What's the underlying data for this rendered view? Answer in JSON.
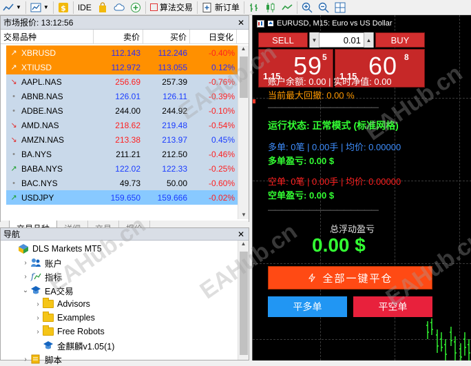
{
  "toolbar": {
    "ide_label": "IDE",
    "algo_label": "算法交易",
    "new_order_label": "新订单"
  },
  "market_watch": {
    "title": "市场报价: 13:12:56",
    "headers": {
      "symbol": "交易品种",
      "bid": "卖价",
      "ask": "买价",
      "change": "日变化"
    },
    "rows": [
      {
        "symbol": "XBRUSD",
        "bid": "112.143",
        "ask": "112.246",
        "change": "-0.40%",
        "dir": "up"
      },
      {
        "symbol": "XTIUSD",
        "bid": "112.972",
        "ask": "113.055",
        "change": "0.12%",
        "dir": "up"
      },
      {
        "symbol": "AAPL.NAS",
        "bid": "256.69",
        "ask": "257.39",
        "change": "-0.76%",
        "dir": "down"
      },
      {
        "symbol": "ABNB.NAS",
        "bid": "126.01",
        "ask": "126.11",
        "change": "-0.39%",
        "dir": "none"
      },
      {
        "symbol": "ADBE.NAS",
        "bid": "244.00",
        "ask": "244.92",
        "change": "-0.10%",
        "dir": "none"
      },
      {
        "symbol": "AMD.NAS",
        "bid": "218.62",
        "ask": "219.48",
        "change": "-0.54%",
        "dir": "down"
      },
      {
        "symbol": "AMZN.NAS",
        "bid": "213.38",
        "ask": "213.97",
        "change": "0.45%",
        "dir": "down"
      },
      {
        "symbol": "BA.NYS",
        "bid": "211.21",
        "ask": "212.50",
        "change": "-0.46%",
        "dir": "none"
      },
      {
        "symbol": "BABA.NYS",
        "bid": "122.02",
        "ask": "122.33",
        "change": "-0.25%",
        "dir": "up"
      },
      {
        "symbol": "BAC.NYS",
        "bid": "49.73",
        "ask": "50.00",
        "change": "-0.60%",
        "dir": "none"
      },
      {
        "symbol": "USDJPY",
        "bid": "159.650",
        "ask": "159.666",
        "change": "-0.02%",
        "dir": "up"
      }
    ],
    "tabs": [
      "交易品种",
      "详细",
      "交易",
      "报价"
    ]
  },
  "navigator": {
    "title": "导航",
    "items": [
      {
        "label": "DLS Markets MT5",
        "level": 0,
        "exp": ""
      },
      {
        "label": "账户",
        "level": 1,
        "exp": ">"
      },
      {
        "label": "指标",
        "level": 1,
        "exp": ">"
      },
      {
        "label": "EA交易",
        "level": 1,
        "exp": "v"
      },
      {
        "label": "Advisors",
        "level": 2,
        "exp": ">"
      },
      {
        "label": "Examples",
        "level": 2,
        "exp": ">"
      },
      {
        "label": "Free Robots",
        "level": 2,
        "exp": ">"
      },
      {
        "label": "金麒麟v1.05(1)",
        "level": 2,
        "exp": ""
      },
      {
        "label": "脚本",
        "level": 1,
        "exp": ">"
      }
    ]
  },
  "chart": {
    "title": "EURUSD, M15: Euro vs US Dollar",
    "sell_label": "SELL",
    "buy_label": "BUY",
    "lot": "0.01",
    "sell_price": {
      "prefix": "1.15",
      "big": "59",
      "sup": "5"
    },
    "buy_price": {
      "prefix": "1.15",
      "big": "60",
      "sup": "8"
    },
    "balance_line": "账户余额: 0.00 | 实时净值: 0.00",
    "drawdown_line": "当前最大回撤: 0.00 %",
    "divider": "————————————————",
    "status_line": "运行状态: 正常模式 (标准网格)",
    "long_line": "多单: 0笔 | 0.00手 | 均价: 0.00000",
    "long_profit": "多单盈亏: 0.00 $",
    "short_line": "空单: 0笔 | 0.00手 | 均价: 0.00000",
    "short_profit": "空单盈亏: 0.00 $",
    "float_label": "总浮动盈亏",
    "float_value": "0.00 $",
    "close_all": "全部一键平仓",
    "close_long": "平多单",
    "close_short": "平空单"
  },
  "watermark": "EAHub.cn"
}
